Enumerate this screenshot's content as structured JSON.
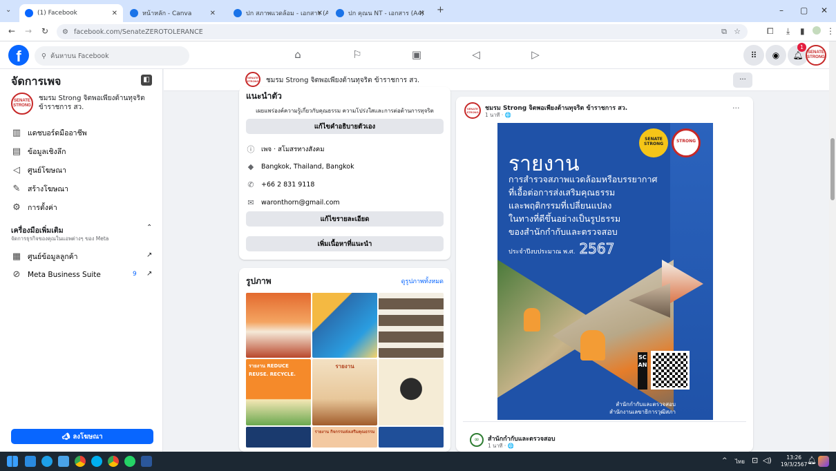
{
  "browser": {
    "tabs": [
      {
        "label": "(1) Facebook",
        "color": "#0866ff"
      },
      {
        "label": "หน้าหลัก - Canva",
        "color": "#1a73e8"
      },
      {
        "label": "ปก สภาพแวดล้อม - เอกสาร (A4)",
        "color": "#1a73e8"
      },
      {
        "label": "ปก คุณน NT - เอกสาร (A4)",
        "color": "#1a73e8"
      }
    ],
    "url": "facebook.com/SenateZEROTOLERANCE",
    "new_tab": "+",
    "window_controls": [
      "–",
      "▢",
      "✕"
    ]
  },
  "header": {
    "logo": "f",
    "search_placeholder": "ค้นหาบน Facebook",
    "notification_count": "1",
    "icons": [
      "home-icon",
      "flag-icon",
      "pages-icon",
      "megaphone-icon",
      "video-icon",
      "grid-menu-icon",
      "messenger-icon",
      "bell-icon"
    ]
  },
  "sidebar": {
    "title": "จัดการเพจ",
    "page_name_line1": "ชมรม Strong จิตพอเพียงต้านทุจริต",
    "page_name_line2": "ข้าราชการ สว.",
    "items": [
      {
        "label": "แดชบอร์ดมืออาชีพ",
        "icon": "dashboard-icon"
      },
      {
        "label": "ข้อมูลเชิงลึก",
        "icon": "insights-icon"
      },
      {
        "label": "ศูนย์โฆษณา",
        "icon": "megaphone-icon"
      },
      {
        "label": "สร้างโฆษณา",
        "icon": "pencil-icon"
      },
      {
        "label": "การตั้งค่า",
        "icon": "gear-icon"
      }
    ],
    "tools_title": "เครื่องมือเพิ่มเติม",
    "tools_subtitle": "จัดการธุรกิจของคุณในแอพต่างๆ ของ Meta",
    "tools": [
      {
        "label": "ศูนย์ข้อมูลลูกค้า",
        "icon": "contacts-icon"
      },
      {
        "label": "Meta Business Suite",
        "icon": "meta-suite-icon",
        "badge": "9"
      }
    ],
    "promote_button": "ลงโฆษณา"
  },
  "page_bar": {
    "name": "ชมรม Strong จิตพอเพียงต้านทุจริต ข้าราชการ สว.",
    "more": "···"
  },
  "intro": {
    "title": "แนะนำตัว",
    "bio": "เผยแพร่องค์ความรู้เกี่ยวกับคุณธรรม ความโปร่งใสและการต่อต้านการทุจริต",
    "edit_bio": "แก้ไขคำอธิบายตัวเอง",
    "category": "เพจ · สโมสรทางสังคม",
    "location": "Bangkok, Thailand, Bangkok",
    "phone": "+66 2 831 9118",
    "email": "waronthorn@gmail.com",
    "edit_details": "แก้ไขรายละเอียด",
    "add_featured": "เพิ่มเนื้อหาที่แนะนำ"
  },
  "photos": {
    "title": "รูปภาพ",
    "see_all": "ดูรูปภาพทั้งหมด",
    "thumbs": [
      {
        "caption": ""
      },
      {
        "caption": ""
      },
      {
        "caption": ""
      },
      {
        "caption": "รายงาน REDUCE REUSE. RECYCLE."
      },
      {
        "caption": "รายงาน"
      },
      {
        "caption": ""
      },
      {
        "caption": ""
      },
      {
        "caption": "รายงาน กิจกรรมส่งเสริมคุณธรรม"
      },
      {
        "caption": ""
      }
    ]
  },
  "post": {
    "author": "ชมรม Strong จิตพอเพียงต้านทุจริต ข้าราชการ สว.",
    "time": "1 นาที · 🌐",
    "more": "···",
    "poster": {
      "heading": "รายงาน",
      "lines": [
        "การสำรวจสภาพแวดล้อมหรือบรรยากาศ",
        "ที่เอื้อต่อการส่งเสริมคุณธรรม",
        "และพฤติกรรมที่เปลี่ยนแปลง",
        "ในทางที่ดีขึ้นอย่างเป็นรูปธรรม",
        "ของสำนักกำกับและตรวจสอบ"
      ],
      "fiscal_year": "ประจำปีงบประมาณ พ.ศ.",
      "year": "2567",
      "scan": "SCAN",
      "footer1": "สำนักกำกับและตรวจสอบ",
      "footer2": "สำนักงานเลขาธิการวุฒิสภา",
      "logo1": "SENATE STRONG",
      "logo2": "STRONG"
    }
  },
  "next_post": {
    "author": "สำนักกำกับและตรวจสอบ",
    "time": "1 นาที · 🌐"
  },
  "taskbar": {
    "time": "13:26",
    "date": "19/3/2567",
    "lang": "ไทย"
  },
  "colors": {
    "fb_blue": "#0866ff",
    "poster_blue": "#1f52a8",
    "poster_orange": "#f39c35"
  }
}
